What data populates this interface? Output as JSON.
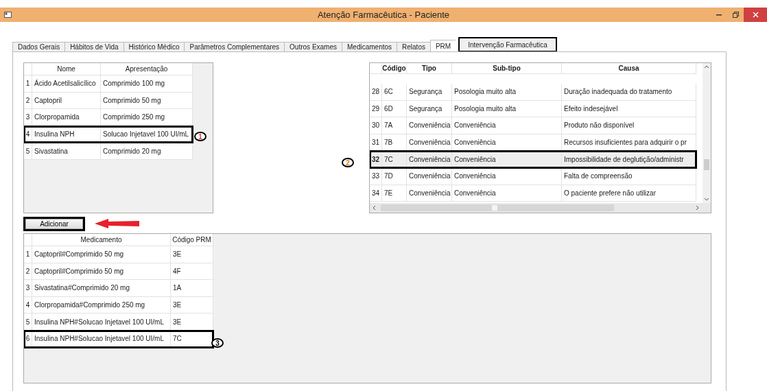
{
  "window": {
    "title": "Atenção Farmacêutica - Paciente"
  },
  "tabs": [
    {
      "label": "Dados Gerais",
      "selected": false,
      "boxed": false
    },
    {
      "label": "Hábitos de Vida",
      "selected": false,
      "boxed": false
    },
    {
      "label": "Histórico Médico",
      "selected": false,
      "boxed": false
    },
    {
      "label": "Parâmetros Complementares",
      "selected": false,
      "boxed": false
    },
    {
      "label": "Outros Exames",
      "selected": false,
      "boxed": false
    },
    {
      "label": "Medicamentos",
      "selected": false,
      "boxed": false
    },
    {
      "label": "Relatos",
      "selected": false,
      "boxed": false
    },
    {
      "label": "PRM",
      "selected": true,
      "boxed": false
    },
    {
      "label": "Intervenção Farmacêutica",
      "selected": false,
      "boxed": true
    }
  ],
  "medications_table": {
    "columns": [
      "Nome",
      "Apresentação"
    ],
    "rows": [
      {
        "number": "1",
        "cells": [
          "Ácido Acetilsalicílico",
          "Comprimido 100 mg"
        ],
        "boxed": false
      },
      {
        "number": "2",
        "cells": [
          "Captopril",
          "Comprimido 50 mg"
        ],
        "boxed": false
      },
      {
        "number": "3",
        "cells": [
          "Clorpropamida",
          "Comprimido 250 mg"
        ],
        "boxed": false
      },
      {
        "number": "4",
        "cells": [
          "Insulina NPH",
          "Solucao Injetavel 100 UI/mL"
        ],
        "boxed": true
      },
      {
        "number": "5",
        "cells": [
          "Sivastatina",
          "Comprimido 20 mg"
        ],
        "boxed": false
      }
    ]
  },
  "prm_table": {
    "columns": [
      "Código",
      "Tipo",
      "Sub-tipo",
      "Causa"
    ],
    "rows": [
      {
        "number": "28",
        "cells": [
          "6C",
          "Segurança",
          "Posologia muito alta",
          "Duração inadequada do tratamento"
        ],
        "selected": false,
        "boxed": false
      },
      {
        "number": "29",
        "cells": [
          "6D",
          "Segurança",
          "Posologia muito alta",
          "Efeito indesejável"
        ],
        "selected": false,
        "boxed": false
      },
      {
        "number": "30",
        "cells": [
          "7A",
          "Conveniência",
          "Conveniência",
          "Produto não disponível"
        ],
        "selected": false,
        "boxed": false
      },
      {
        "number": "31",
        "cells": [
          "7B",
          "Conveniência",
          "Conveniência",
          "Recursos insuficientes para adquirir o pr"
        ],
        "selected": false,
        "boxed": false
      },
      {
        "number": "32",
        "cells": [
          "7C",
          "Conveniência",
          "Conveniência",
          "Impossibilidade de deglutição/administr"
        ],
        "selected": true,
        "boxed": true
      },
      {
        "number": "33",
        "cells": [
          "7D",
          "Conveniência",
          "Conveniência",
          "Falta de compreensão"
        ],
        "selected": false,
        "boxed": false
      },
      {
        "number": "34",
        "cells": [
          "7E",
          "Conveniência",
          "Conveniência",
          "O paciente prefere não utilizar"
        ],
        "selected": false,
        "boxed": false
      }
    ]
  },
  "add_button": {
    "label": "Adicionar",
    "boxed": true
  },
  "result_table": {
    "columns": [
      "Medicamento",
      "Código PRM"
    ],
    "rows": [
      {
        "number": "1",
        "cells": [
          "Captopril#Comprimido 50 mg",
          "3E"
        ],
        "boxed": false
      },
      {
        "number": "2",
        "cells": [
          "Captopril#Comprimido 50 mg",
          "4F"
        ],
        "boxed": false
      },
      {
        "number": "3",
        "cells": [
          "Sivastatina#Comprimido 20 mg",
          "1A"
        ],
        "boxed": false
      },
      {
        "number": "4",
        "cells": [
          "Clorpropamida#Comprimido 250 mg",
          "3E"
        ],
        "boxed": false
      },
      {
        "number": "5",
        "cells": [
          "Insulina NPH#Solucao Injetavel 100 UI/mL",
          "3E"
        ],
        "boxed": false
      },
      {
        "number": "6",
        "cells": [
          "Insulina NPH#Solucao Injetavel 100 UI/mL",
          "7C"
        ],
        "boxed": true
      }
    ]
  },
  "callouts": [
    {
      "label": "1",
      "color": "#e8303a"
    },
    {
      "label": "2",
      "color": "#e07a20"
    },
    {
      "label": "3",
      "color": "#000000"
    }
  ]
}
